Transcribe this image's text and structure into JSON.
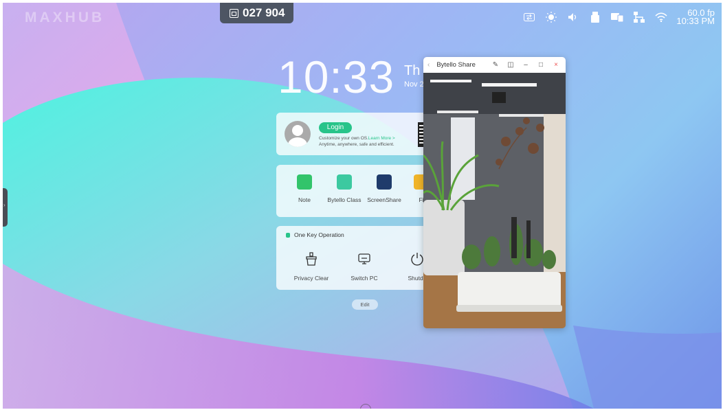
{
  "brand": "MAXHUB",
  "code_pill": {
    "icon": "screen-code-icon",
    "code": "027 904"
  },
  "tray": {
    "icons": [
      "switch-icon",
      "brightness-icon",
      "volume-icon",
      "usb-icon",
      "display-icon",
      "network-icon",
      "wifi-icon"
    ],
    "fps": "60.0 fp",
    "time": "10:33 PM"
  },
  "clock": {
    "time": "10:33",
    "day": "Th",
    "date": "Nov 2"
  },
  "login": {
    "button": "Login",
    "tip_line1": "Customize your own OS.",
    "learn_more": "Learn More >",
    "tip_line2": "Anytime, anywhere, safe and efficient."
  },
  "apps": [
    {
      "label": "Note",
      "color": "#32c46b"
    },
    {
      "label": "Bytello Class",
      "color": "#3cc9a0"
    },
    {
      "label": "ScreenShare",
      "color": "#1f3b6b"
    },
    {
      "label": "Fi",
      "color": "#f0b429"
    }
  ],
  "ops": {
    "title": "One Key Operation",
    "items": [
      {
        "label": "Privacy Clear"
      },
      {
        "label": "Switch PC"
      },
      {
        "label": "Shutdo"
      }
    ]
  },
  "edit": "Edit",
  "share_window": {
    "title": "Bytello Share"
  },
  "colors": {
    "accent": "#28c48a",
    "pill": "#4d5563"
  }
}
